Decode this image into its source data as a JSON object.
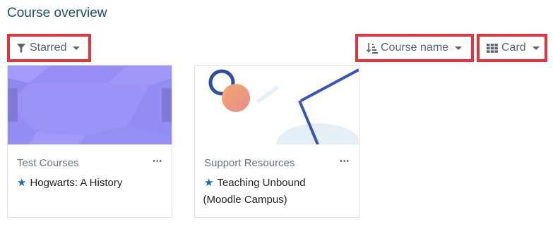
{
  "page": {
    "title": "Course overview"
  },
  "filters": {
    "grouping": {
      "label": "Starred",
      "icon": "filter-icon"
    },
    "sort": {
      "label": "Course name",
      "icon": "sort-icon"
    },
    "view": {
      "label": "Card",
      "icon": "grid-icon"
    }
  },
  "courses": [
    {
      "category": "Test Courses",
      "name": "Hogwarts: A History",
      "starred": true,
      "menu": "···",
      "image_color": "#9a93f8"
    },
    {
      "category": "Support Resources",
      "name_line1": "Teaching Unbound",
      "name_line2": "(Moodle Campus)",
      "starred": true,
      "menu": "···"
    }
  ],
  "colors": {
    "highlight": "#e2343e",
    "accent": "#0f6cbf",
    "title": "#1e4d5c"
  }
}
